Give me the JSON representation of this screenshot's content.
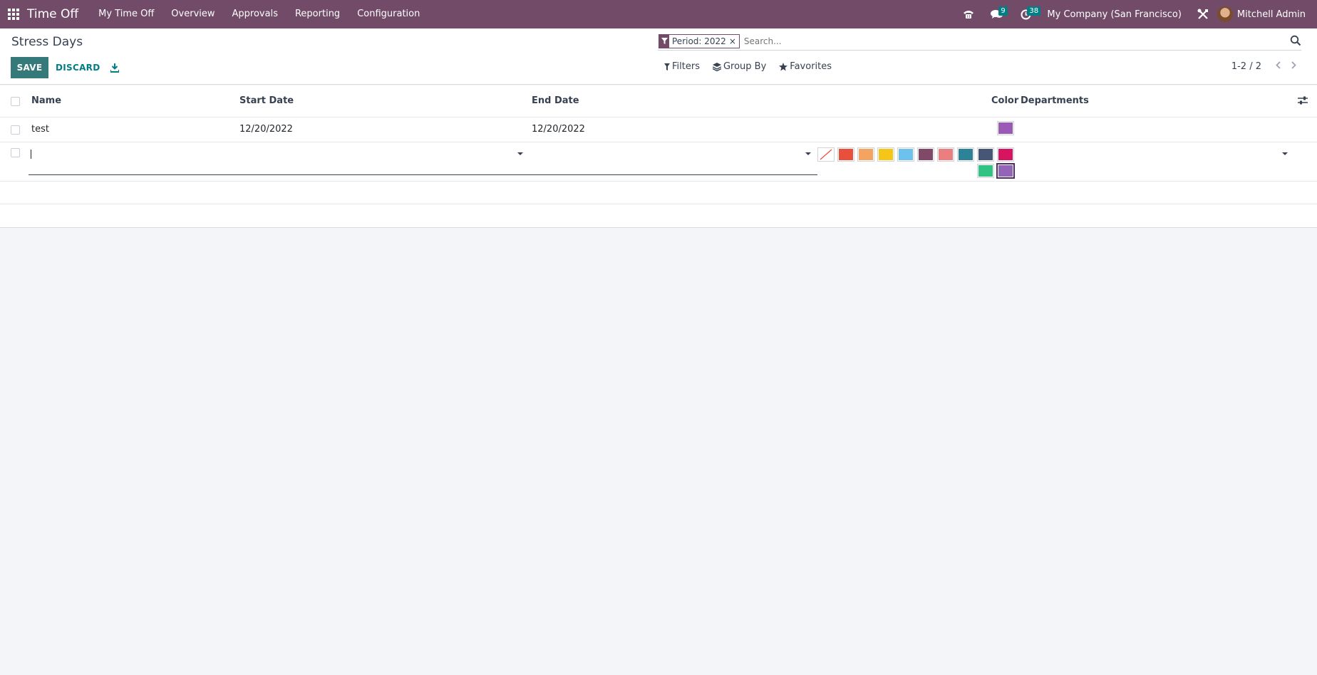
{
  "navbar": {
    "app_name": "Time Off",
    "menu": [
      "My Time Off",
      "Overview",
      "Approvals",
      "Reporting",
      "Configuration"
    ],
    "messages_count": "9",
    "activities_count": "38",
    "company": "My Company (San Francisco)",
    "user": "Mitchell Admin",
    "accent_color": "#714b67"
  },
  "control": {
    "title": "Stress Days",
    "save_label": "SAVE",
    "discard_label": "DISCARD",
    "facet_label": "Period: 2022",
    "facet_close": "×",
    "search_placeholder": "Search...",
    "filters_label": "Filters",
    "groupby_label": "Group By",
    "favorites_label": "Favorites",
    "pager": "1-2 / 2"
  },
  "table": {
    "columns": {
      "name": "Name",
      "start_date": "Start Date",
      "end_date": "End Date",
      "color": "Color",
      "departments": "Departments"
    },
    "rows": [
      {
        "name": "test",
        "start_date": "12/20/2022",
        "end_date": "12/20/2022",
        "color": "#9b59b6"
      }
    ],
    "palette": [
      "none",
      "#e8503c",
      "#f4a460",
      "#f5c518",
      "#6cc1ed",
      "#814968",
      "#eb7e7f",
      "#2c8397",
      "#475577",
      "#d6145f",
      "#30c381",
      "#9365b8"
    ]
  }
}
